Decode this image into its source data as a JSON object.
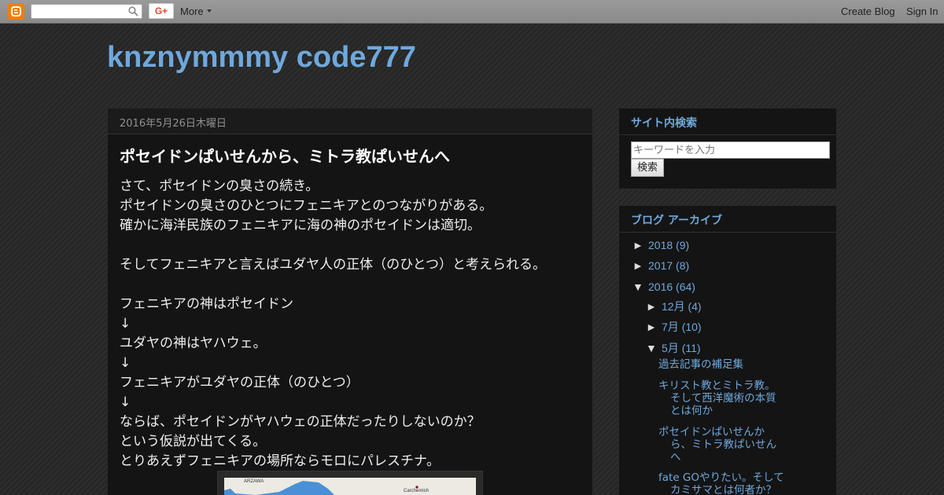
{
  "navbar": {
    "gplus_label": "G+",
    "more_label": "More",
    "create_blog": "Create Blog",
    "sign_in": "Sign In"
  },
  "blog": {
    "title": "knznymmmy code777"
  },
  "post": {
    "date": "2016年5月26日木曜日",
    "title": "ポセイドンぱいせんから、ミトラ教ぱいせんへ",
    "lines": [
      "さて、ポセイドンの臭さの続き。",
      "ポセイドンの臭さのひとつにフェニキアとのつながりがある。",
      "確かに海洋民族のフェニキアに海の神のポセイドンは適切。",
      "",
      "そしてフェニキアと言えばユダヤ人の正体（のひとつ）と考えられる。",
      "",
      "フェニキアの神はポセイドン",
      "↓",
      "ユダヤの神はヤハウェ。",
      "↓",
      "フェニキアがユダヤの正体（のひとつ）",
      "↓",
      "ならば、ポセイドンがヤハウェの正体だったりしないのか？",
      "という仮説が出てくる。",
      "とりあえずフェニキアの場所ならモロにパレスチナ。"
    ],
    "map_labels": [
      "ARZAWA",
      "Carchemish"
    ]
  },
  "sidebar": {
    "search": {
      "title": "サイト内検索",
      "placeholder": "キーワードを入力",
      "button": "検索"
    },
    "archive": {
      "title": "ブログ アーカイブ",
      "years": [
        {
          "toggle": "►",
          "label": "2018",
          "count": "(9)"
        },
        {
          "toggle": "►",
          "label": "2017",
          "count": "(8)"
        },
        {
          "toggle": "▼",
          "label": "2016",
          "count": "(64)"
        }
      ],
      "months": [
        {
          "toggle": "►",
          "label": "12月",
          "count": "(4)"
        },
        {
          "toggle": "►",
          "label": "7月",
          "count": "(10)"
        },
        {
          "toggle": "▼",
          "label": "5月",
          "count": "(11)"
        }
      ],
      "posts": [
        {
          "l1": "過去記事の補足集",
          "l2": "",
          "l3": ""
        },
        {
          "l1": "キリスト教とミトラ教。",
          "l2": "そして西洋魔術の本質",
          "l3": "とは何か"
        },
        {
          "l1": "ポセイドンぱいせんか",
          "l2": "ら、ミトラ教ぱいせん",
          "l3": "へ"
        },
        {
          "l1": "fate GOやりたい。そして",
          "l2": "カミサマとは何者か？",
          "l3": ""
        }
      ]
    }
  },
  "colors": {
    "accent": "#6fa8dc",
    "blogger_orange": "#f57d00"
  }
}
